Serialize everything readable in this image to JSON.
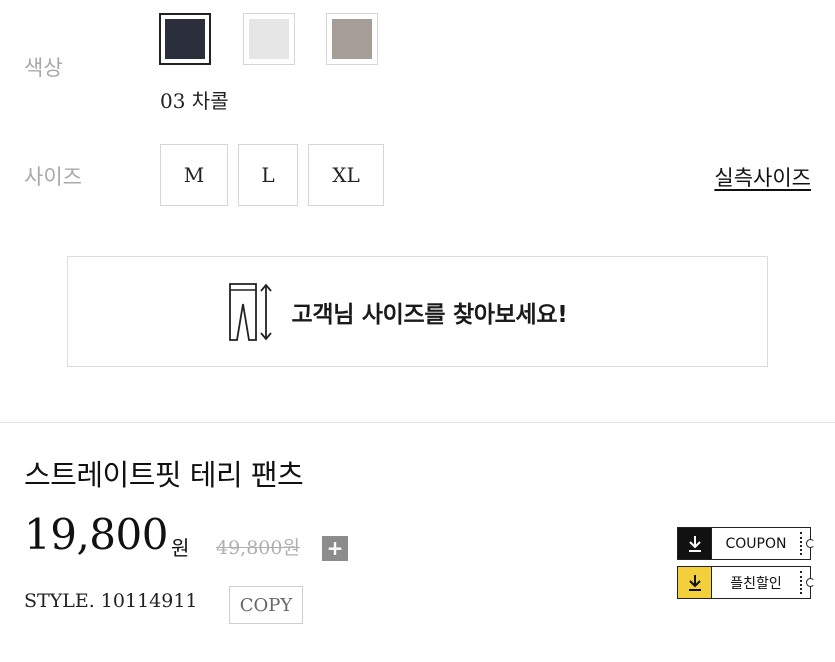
{
  "color": {
    "label": "색상",
    "selected_name": "03 차콜",
    "swatches": [
      {
        "name": "charcoal",
        "hex": "#2b2e3b",
        "selected": true
      },
      {
        "name": "light-gray",
        "hex": "#e6e6e6",
        "selected": false
      },
      {
        "name": "taupe",
        "hex": "#a49e96",
        "selected": false
      }
    ]
  },
  "size": {
    "label": "사이즈",
    "options": [
      "M",
      "L",
      "XL"
    ],
    "chart_link": "실측사이즈"
  },
  "find_size": {
    "text": "고객님 사이즈를 찾아보세요!",
    "icon": "pants-measure-icon"
  },
  "product": {
    "name": "스트레이트핏 테리 팬츠",
    "price": "19,800",
    "price_unit": "원",
    "original_price": "49,800원",
    "plus_label": "+",
    "style_no": "STYLE. 10114911",
    "copy_label": "COPY"
  },
  "coupons": [
    {
      "label": "COUPON",
      "icon": "download-icon",
      "color": "#111111"
    },
    {
      "label": "플친할인",
      "icon": "download-icon",
      "color": "#f2cf3b"
    }
  ]
}
